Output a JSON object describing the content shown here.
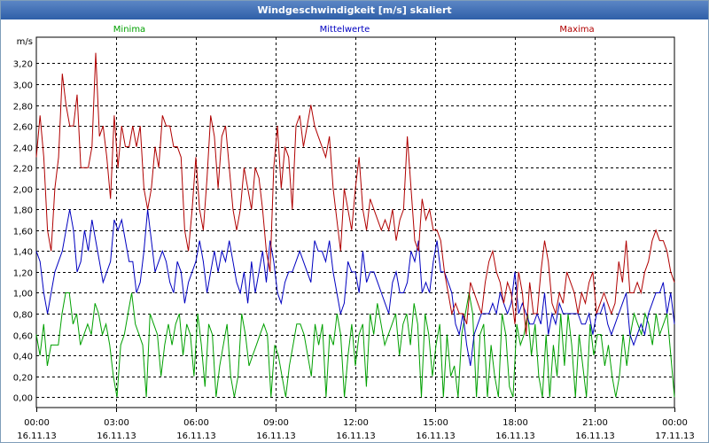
{
  "window": {
    "title": "Windgeschwindigkeit [m/s] skaliert"
  },
  "chart_data": {
    "type": "line",
    "title": "Windgeschwindigkeit [m/s] skaliert",
    "ylabel": "m/s",
    "xlabel": "",
    "ylim": [
      -0.1,
      3.45
    ],
    "xlim_hours": [
      0,
      24
    ],
    "grid": true,
    "legend_position": "top",
    "y_ticks": [
      "0,00",
      "0,20",
      "0,40",
      "0,60",
      "0,80",
      "1,00",
      "1,20",
      "1,40",
      "1,60",
      "1,80",
      "2,00",
      "2,20",
      "2,40",
      "2,60",
      "2,80",
      "3,00",
      "3,20"
    ],
    "y_tick_values": [
      0,
      0.2,
      0.4,
      0.6,
      0.8,
      1.0,
      1.2,
      1.4,
      1.6,
      1.8,
      2.0,
      2.2,
      2.4,
      2.6,
      2.8,
      3.0,
      3.2
    ],
    "x_ticks": [
      {
        "time": "00:00",
        "date": "16.11.13"
      },
      {
        "time": "03:00",
        "date": "16.11.13"
      },
      {
        "time": "06:00",
        "date": "16.11.13"
      },
      {
        "time": "09:00",
        "date": "16.11.13"
      },
      {
        "time": "12:00",
        "date": "16.11.13"
      },
      {
        "time": "15:00",
        "date": "16.11.13"
      },
      {
        "time": "18:00",
        "date": "16.11.13"
      },
      {
        "time": "21:00",
        "date": "16.11.13"
      },
      {
        "time": "00:00",
        "date": "17.11.13"
      }
    ],
    "series": [
      {
        "name": "Minima",
        "color": "#00a000",
        "values": [
          0.6,
          0.4,
          0.7,
          0.3,
          0.5,
          0.5,
          0.5,
          0.8,
          1.0,
          1.0,
          0.7,
          0.8,
          0.5,
          0.6,
          0.7,
          0.6,
          0.9,
          0.8,
          0.6,
          0.7,
          0.5,
          0.2,
          0.0,
          0.5,
          0.6,
          0.8,
          1.0,
          0.7,
          0.6,
          0.5,
          0.0,
          0.8,
          0.7,
          0.6,
          0.2,
          0.5,
          0.7,
          0.5,
          0.7,
          0.8,
          0.4,
          0.7,
          0.6,
          0.2,
          0.8,
          0.5,
          0.1,
          0.7,
          0.6,
          0.0,
          0.3,
          0.5,
          0.7,
          0.2,
          0.0,
          0.2,
          0.8,
          0.6,
          0.3,
          0.4,
          0.5,
          0.6,
          0.7,
          0.6,
          0.0,
          0.5,
          0.4,
          0.2,
          0.0,
          0.3,
          0.5,
          0.7,
          0.7,
          0.6,
          0.4,
          0.2,
          0.7,
          0.5,
          0.7,
          0.0,
          0.6,
          0.5,
          0.8,
          0.6,
          0.0,
          0.4,
          0.7,
          0.3,
          0.6,
          0.7,
          0.1,
          0.8,
          0.6,
          0.9,
          0.7,
          0.5,
          0.6,
          0.7,
          0.8,
          0.4,
          0.7,
          0.8,
          0.5,
          0.9,
          0.7,
          0.0,
          0.8,
          0.6,
          0.2,
          0.5,
          0.7,
          0.0,
          0.6,
          0.2,
          0.3,
          0.0,
          0.6,
          0.8,
          1.0,
          0.8,
          0.0,
          0.6,
          0.7,
          0.0,
          0.5,
          0.2,
          0.0,
          0.8,
          0.6,
          0.1,
          0.0,
          0.7,
          0.5,
          0.6,
          0.8,
          0.4,
          0.7,
          0.2,
          0.0,
          0.6,
          0.0,
          0.5,
          0.2,
          0.8,
          0.3,
          0.8,
          0.5,
          0.0,
          0.6,
          0.3,
          0.0,
          0.7,
          0.4,
          0.6,
          0.6,
          0.3,
          0.5,
          0.2,
          0.0,
          0.2,
          0.6,
          0.3,
          0.6,
          0.8,
          0.7,
          0.6,
          0.8,
          0.7,
          0.5,
          0.8,
          0.6,
          0.7,
          0.8,
          0.4,
          0.0
        ]
      },
      {
        "name": "Mittelwerte",
        "color": "#0000c0",
        "values": [
          1.4,
          1.3,
          1.0,
          0.8,
          1.0,
          1.2,
          1.3,
          1.4,
          1.6,
          1.8,
          1.6,
          1.2,
          1.3,
          1.6,
          1.4,
          1.7,
          1.5,
          1.3,
          1.1,
          1.2,
          1.3,
          1.7,
          1.6,
          1.7,
          1.5,
          1.3,
          1.3,
          1.0,
          1.1,
          1.4,
          1.8,
          1.5,
          1.2,
          1.3,
          1.4,
          1.3,
          1.1,
          1.0,
          1.3,
          1.2,
          0.9,
          1.1,
          1.2,
          1.3,
          1.5,
          1.3,
          1.0,
          1.2,
          1.4,
          1.2,
          1.4,
          1.3,
          1.5,
          1.3,
          1.1,
          1.0,
          1.2,
          0.9,
          1.3,
          1.0,
          1.2,
          1.4,
          1.1,
          1.5,
          1.3,
          1.0,
          0.9,
          1.1,
          1.2,
          1.2,
          1.3,
          1.4,
          1.3,
          1.2,
          1.1,
          1.5,
          1.4,
          1.4,
          1.3,
          1.5,
          1.2,
          1.0,
          0.8,
          0.9,
          1.3,
          1.2,
          1.2,
          1.0,
          1.4,
          1.1,
          1.2,
          1.2,
          1.1,
          1.0,
          0.9,
          0.8,
          1.1,
          1.2,
          1.0,
          1.0,
          1.1,
          1.4,
          1.3,
          1.5,
          1.0,
          1.1,
          1.0,
          1.3,
          1.5,
          1.2,
          1.2,
          1.1,
          1.0,
          0.7,
          0.6,
          0.8,
          0.5,
          0.3,
          0.6,
          0.7,
          0.8,
          0.8,
          0.8,
          0.9,
          0.8,
          1.0,
          0.9,
          0.8,
          0.9,
          1.2,
          0.8,
          0.9,
          0.8,
          0.7,
          0.7,
          0.8,
          0.7,
          1.0,
          0.6,
          0.8,
          0.7,
          0.9,
          0.8,
          0.8,
          0.8,
          0.8,
          0.8,
          0.7,
          0.7,
          0.8,
          0.6,
          0.8,
          0.8,
          0.9,
          0.7,
          0.6,
          0.7,
          0.8,
          0.9,
          1.0,
          0.6,
          0.5,
          0.6,
          0.7,
          0.6,
          0.8,
          0.9,
          1.0,
          1.0,
          1.1,
          0.8,
          1.0,
          0.7
        ]
      },
      {
        "name": "Maxima",
        "color": "#b00000",
        "values": [
          2.3,
          2.7,
          2.3,
          1.6,
          1.4,
          2.0,
          2.3,
          3.1,
          2.8,
          2.6,
          2.6,
          2.9,
          2.2,
          2.2,
          2.2,
          2.4,
          3.3,
          2.5,
          2.6,
          2.3,
          1.9,
          2.7,
          2.2,
          2.6,
          2.4,
          2.4,
          2.6,
          2.4,
          2.6,
          2.0,
          1.8,
          2.0,
          2.4,
          2.2,
          2.7,
          2.6,
          2.6,
          2.4,
          2.4,
          2.3,
          1.6,
          1.4,
          1.8,
          2.3,
          1.8,
          1.6,
          2.1,
          2.7,
          2.5,
          2.0,
          2.5,
          2.6,
          2.2,
          1.8,
          1.6,
          1.8,
          2.2,
          2.0,
          1.8,
          2.2,
          2.1,
          1.8,
          1.4,
          1.2,
          2.2,
          2.6,
          2.0,
          2.4,
          2.3,
          1.8,
          2.6,
          2.7,
          2.4,
          2.6,
          2.8,
          2.6,
          2.5,
          2.4,
          2.3,
          2.5,
          2.0,
          1.7,
          1.4,
          2.0,
          1.8,
          1.6,
          2.0,
          2.3,
          1.8,
          1.6,
          1.9,
          1.8,
          1.7,
          1.6,
          1.7,
          1.6,
          1.8,
          1.5,
          1.7,
          1.8,
          2.5,
          2.0,
          1.5,
          1.4,
          1.9,
          1.7,
          1.8,
          1.6,
          1.6,
          1.5,
          1.2,
          1.0,
          0.8,
          0.9,
          0.8,
          0.8,
          0.7,
          1.1,
          1.0,
          0.9,
          0.8,
          1.1,
          1.3,
          1.4,
          1.2,
          1.1,
          0.9,
          1.1,
          1.0,
          0.7,
          1.2,
          1.0,
          0.6,
          1.1,
          0.8,
          0.8,
          1.2,
          1.5,
          1.3,
          0.9,
          0.8,
          1.0,
          0.9,
          1.2,
          1.1,
          1.0,
          0.8,
          1.0,
          0.9,
          1.1,
          1.2,
          0.8,
          0.9,
          1.0,
          0.9,
          0.8,
          0.9,
          1.3,
          1.1,
          1.5,
          1.0,
          1.0,
          1.1,
          1.0,
          1.2,
          1.3,
          1.5,
          1.6,
          1.5,
          1.5,
          1.4,
          1.2,
          1.1
        ]
      }
    ]
  }
}
